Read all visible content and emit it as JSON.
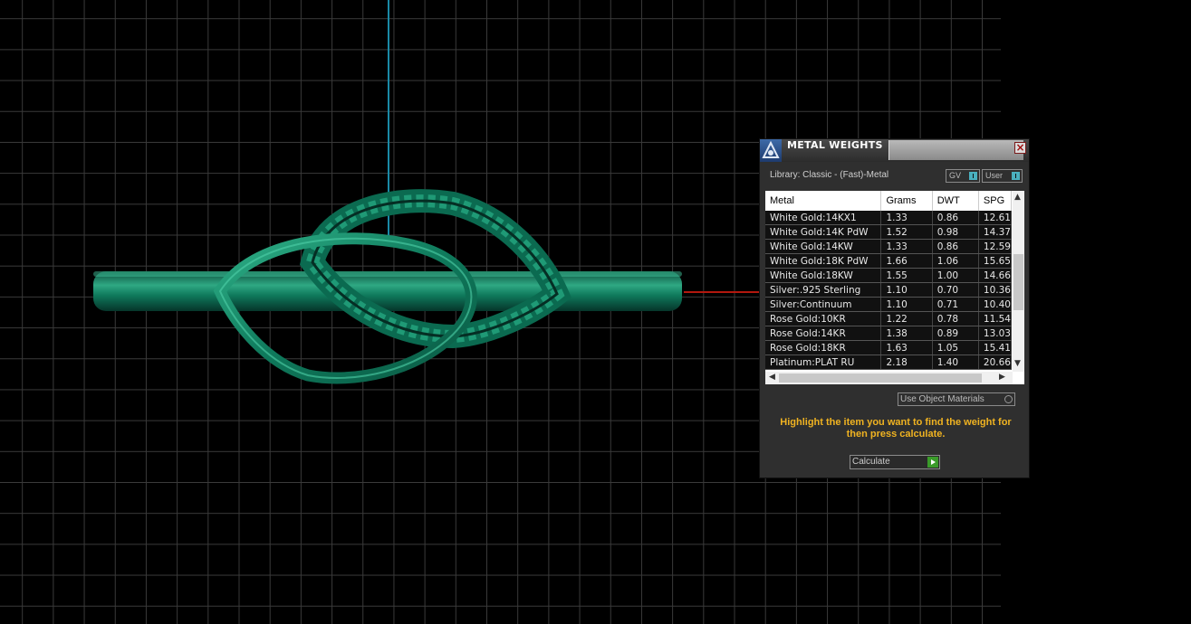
{
  "panel": {
    "title": "METAL WEIGHTS",
    "close_symbol": "×",
    "library_label": "Library: Classic - (Fast)-Metal",
    "gv_label": "GV",
    "user_label": "User",
    "use_object_materials": "Use Object Materials",
    "hint": "Highlight the item you want to find the weight for then press calculate.",
    "calculate_label": "Calculate",
    "columns": [
      "Metal",
      "Grams",
      "DWT",
      "SPG"
    ],
    "rows": [
      [
        "White Gold:14KX1",
        "1.33",
        "0.86",
        "12.61"
      ],
      [
        "White Gold:14K PdW",
        "1.52",
        "0.98",
        "14.37"
      ],
      [
        "White Gold:14KW",
        "1.33",
        "0.86",
        "12.59"
      ],
      [
        "White Gold:18K PdW",
        "1.66",
        "1.06",
        "15.65"
      ],
      [
        "White Gold:18KW",
        "1.55",
        "1.00",
        "14.66"
      ],
      [
        "Silver:.925 Sterling",
        "1.10",
        "0.70",
        "10.36"
      ],
      [
        "Silver:Continuum",
        "1.10",
        "0.71",
        "10.40"
      ],
      [
        "Rose Gold:10KR",
        "1.22",
        "0.78",
        "11.54"
      ],
      [
        "Rose Gold:14KR",
        "1.38",
        "0.89",
        "13.03"
      ],
      [
        "Rose Gold:18KR",
        "1.63",
        "1.05",
        "15.41"
      ],
      [
        "Platinum:PLAT RU",
        "2.18",
        "1.40",
        "20.66"
      ]
    ]
  },
  "colors": {
    "ring_green": "#0f7a5c",
    "axis_y": "#1a8aa6",
    "axis_x": "#b3180e",
    "hint_text": "#f0b321"
  }
}
